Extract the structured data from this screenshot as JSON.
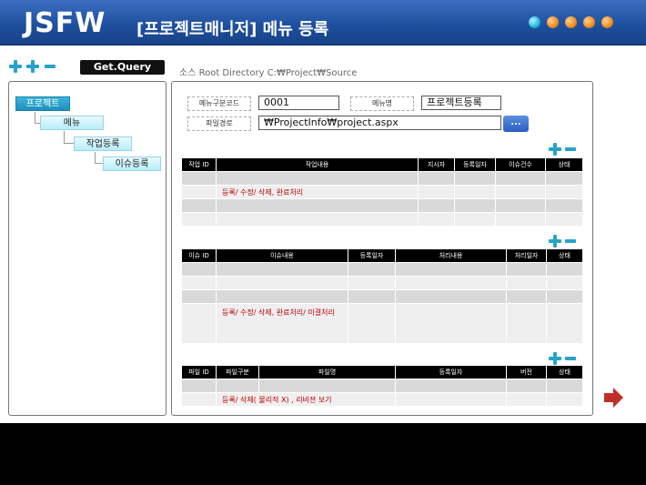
{
  "app": {
    "logo": "JSFW",
    "title": "[프로젝트매니저] 메뉴 등록"
  },
  "toolbar": {
    "get_query": "Get.Query",
    "source_dir": "소스 Root Directory C:₩Project₩Source"
  },
  "tree": {
    "items": [
      "프로젝트",
      "메뉴",
      "작업등록",
      "이슈등록"
    ]
  },
  "form": {
    "menu_code_label": "메뉴구분코드",
    "menu_code_value": "0001",
    "menu_name_label": "메뉴명",
    "menu_name_value": "프로젝트등록",
    "file_path_label": "파일경로",
    "file_path_value": "₩ProjectInfo₩project.aspx",
    "browse_label": "..."
  },
  "task_table": {
    "headers": [
      "작업 ID",
      "작업내용",
      "지시자",
      "등록일자",
      "이슈건수",
      "상태"
    ],
    "note": "등록/ 수정/ 삭제, 완료처리"
  },
  "issue_table": {
    "headers": [
      "이슈 ID",
      "이슈내용",
      "등록일자",
      "처리내용",
      "처리일자",
      "상태"
    ],
    "note": "등록/ 수정/ 삭제, 완료처리/ 미결처리"
  },
  "file_table": {
    "headers": [
      "파일 ID",
      "파일구분",
      "파일명",
      "등록일자",
      "버전",
      "상태"
    ],
    "note": "등록/ 삭제( 물리적 X) , 리비젼 보기"
  },
  "colors": {
    "header_blue": "#1d4e9d",
    "accent_cyan": "#27a3c9",
    "note_red": "#c00000"
  }
}
